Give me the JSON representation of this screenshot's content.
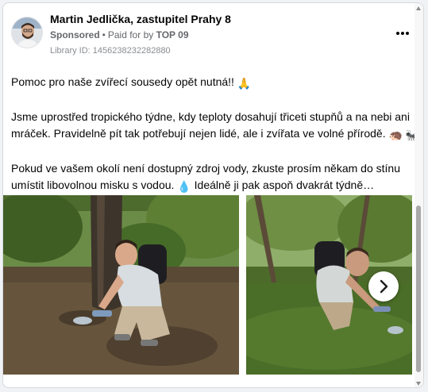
{
  "post": {
    "author": "Martin Jedlička, zastupitel Prahy 8",
    "sponsored": "Sponsored",
    "dot": "•",
    "paid_for_by": "Paid for by",
    "payer": "TOP 09",
    "library_id": "Library ID: 1456238232282880",
    "more_icon": "more-horizontal-icon"
  },
  "body": {
    "p1": "Pomoc pro naše zvířecí sousedy opět nutná!!",
    "p1_emoji": "🙏",
    "p2": "Jsme uprostřed tropického týdne, kdy teploty dosahují třiceti stupňů a na nebi ani mráček. Pravidelně pít tak potřebují nejen lidé, ale i zvířata ve volné přírodě.",
    "p2_emoji_1": "🦔",
    "p2_emoji_2": "🐜",
    "p3_a": "Pokud ve vašem okolí není dostupný zdroj vody, zkuste prosím někam do stínu umístit libovolnou misku s vodou.",
    "p3_emoji": "💧",
    "p3_b": "Ideálně ji pak aspoň dvakrát týdně…"
  },
  "gallery": {
    "next_icon": "chevron-right-icon"
  },
  "colors": {
    "text": "#050505",
    "secondary": "#65676b",
    "meta_light": "#8a8d91"
  }
}
